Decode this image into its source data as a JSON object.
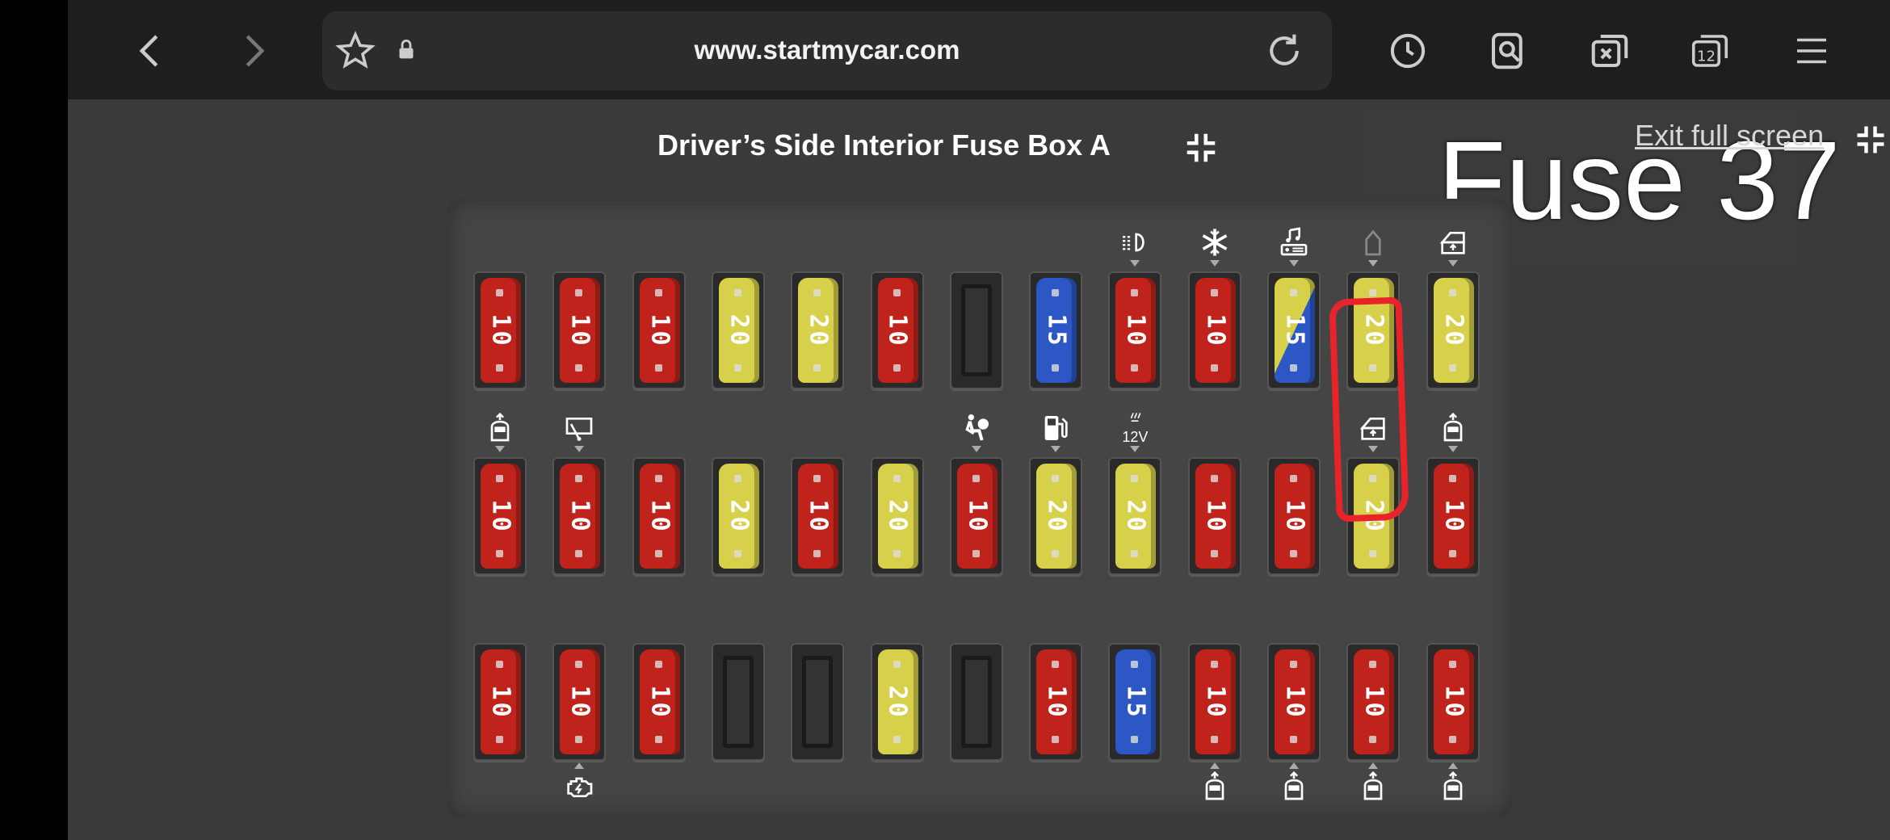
{
  "browser": {
    "url": "www.startmycar.com",
    "tabs_count": "12",
    "icons": {
      "back": "back-arrow-icon",
      "forward": "forward-arrow-icon",
      "favorite": "star-icon",
      "lock": "lock-icon",
      "reload": "reload-icon",
      "history": "clock-icon",
      "find": "find-in-page-icon",
      "close_tabs": "close-tabs-icon",
      "tabs": "tabs-icon",
      "menu": "hamburger-menu-icon"
    }
  },
  "page": {
    "title": "Driver’s Side Interior Fuse Box A",
    "exit_fullscreen": "Exit full screen",
    "overlay_label": "Fuse 37"
  },
  "colors": {
    "red": "#c0231c",
    "yellow": "#d7d04b",
    "blue": "#2d57c4",
    "highlight": "#e8232a"
  },
  "fusebox": {
    "row1": [
      {
        "type": "red",
        "amp": "10"
      },
      {
        "type": "red",
        "amp": "10"
      },
      {
        "type": "red",
        "amp": "10"
      },
      {
        "type": "yellow",
        "amp": "20"
      },
      {
        "type": "yellow",
        "amp": "20"
      },
      {
        "type": "red",
        "amp": "10"
      },
      {
        "type": "empty",
        "amp": ""
      },
      {
        "type": "blue",
        "amp": "15"
      },
      {
        "type": "red",
        "amp": "10",
        "icon": "headlight-icon"
      },
      {
        "type": "red",
        "amp": "10",
        "icon": "snowflake-icon"
      },
      {
        "type": "split",
        "amp": "15",
        "icon": "audio-system-icon"
      },
      {
        "type": "yellow",
        "amp": "20",
        "icon": "door-icon"
      },
      {
        "type": "yellow",
        "amp": "20",
        "icon": "window-icon"
      }
    ],
    "row2": [
      {
        "type": "red",
        "amp": "10",
        "icon": "door-lock-icon"
      },
      {
        "type": "red",
        "amp": "10",
        "icon": "wiper-icon"
      },
      {
        "type": "red",
        "amp": "10"
      },
      {
        "type": "yellow",
        "amp": "20"
      },
      {
        "type": "red",
        "amp": "10"
      },
      {
        "type": "yellow",
        "amp": "20"
      },
      {
        "type": "red",
        "amp": "10",
        "icon": "airbag-icon"
      },
      {
        "type": "yellow",
        "amp": "20",
        "icon": "fuel-pump-icon"
      },
      {
        "type": "yellow",
        "amp": "20",
        "icon": "power-outlet-icon",
        "icon_text": "12V"
      },
      {
        "type": "red",
        "amp": "10"
      },
      {
        "type": "red",
        "amp": "10"
      },
      {
        "type": "yellow",
        "amp": "20",
        "icon": "window-icon"
      },
      {
        "type": "red",
        "amp": "10",
        "icon": "door-lock-icon"
      }
    ],
    "row3": [
      {
        "type": "red",
        "amp": "10"
      },
      {
        "type": "red",
        "amp": "10",
        "icon": "engine-icon"
      },
      {
        "type": "red",
        "amp": "10"
      },
      {
        "type": "empty",
        "amp": ""
      },
      {
        "type": "empty",
        "amp": ""
      },
      {
        "type": "yellow",
        "amp": "20"
      },
      {
        "type": "empty",
        "amp": ""
      },
      {
        "type": "red",
        "amp": "10"
      },
      {
        "type": "blue",
        "amp": "15"
      },
      {
        "type": "red",
        "amp": "10",
        "icon": "door-lock-icon"
      },
      {
        "type": "red",
        "amp": "10",
        "icon": "door-lock-icon"
      },
      {
        "type": "red",
        "amp": "10",
        "icon": "door-lock-icon"
      },
      {
        "type": "red",
        "amp": "10",
        "icon": "door-lock-icon"
      }
    ]
  }
}
